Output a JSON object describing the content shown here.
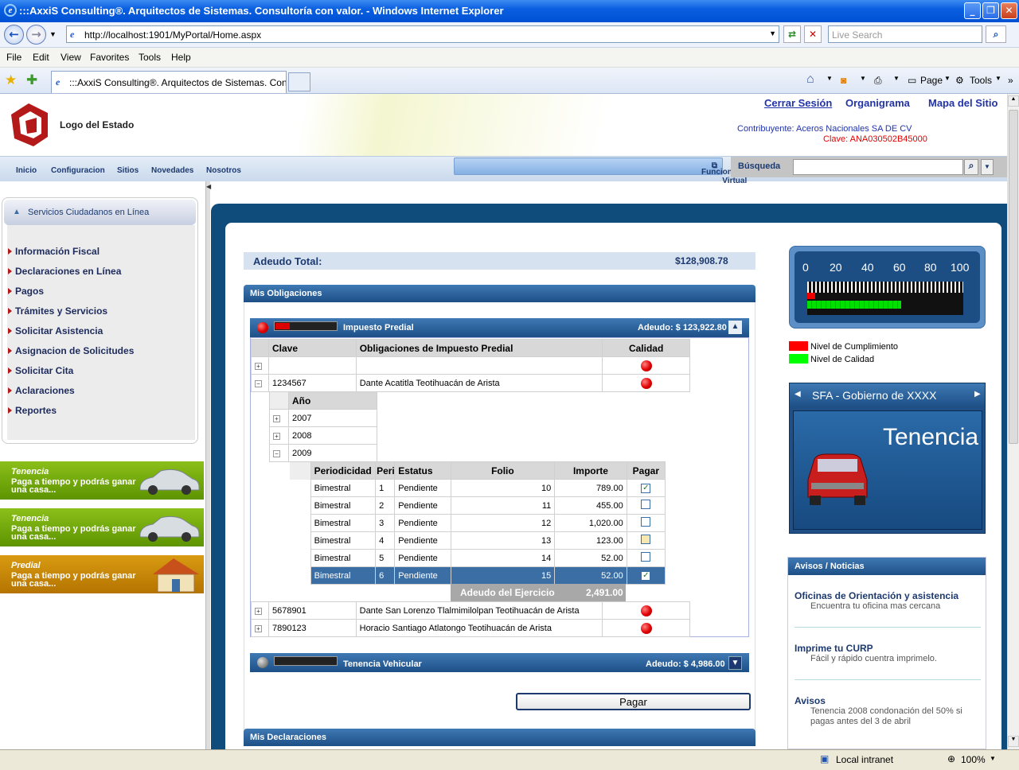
{
  "window": {
    "title": ":::AxxiS Consulting®. Arquitectos de Sistemas. Consultoría con valor. - Windows Internet Explorer"
  },
  "address": {
    "url": "http://localhost:1901/MyPortal/Home.aspx",
    "search_placeholder": "Live Search"
  },
  "menu": [
    "File",
    "Edit",
    "View",
    "Favorites",
    "Tools",
    "Help"
  ],
  "tab": {
    "title": ":::AxxiS Consulting®. Arquitectos de Sistemas. Cons..."
  },
  "commands": {
    "page": "Page",
    "tools": "Tools"
  },
  "header": {
    "logo": "Logo del Estado",
    "links": [
      "Cerrar Sesión",
      "Organigrama",
      "Mapa del Sitio"
    ],
    "contribuyente": "Contribuyente: Aceros Nacionales SA DE CV",
    "clave": "Clave: ANA030502B45000"
  },
  "nav": [
    "Inicio",
    "Configuracion",
    "Sitios",
    "Novedades",
    "Nosotros"
  ],
  "funcionario": "Funcionario Virtual",
  "busqueda": "Búsqueda",
  "left": {
    "title": "Servicios Ciudadanos en Línea",
    "items": [
      "Información Fiscal",
      "Declaraciones en Línea",
      "Pagos",
      "Trámites y Servicios",
      "Solicitar Asistencia",
      "Asignacion de Solicitudes",
      "Solicitar Cita",
      "Aclaraciones",
      "Reportes"
    ],
    "promos": [
      {
        "title": "Tenencia",
        "text": "Paga a tiempo y podrás ganar una casa..."
      },
      {
        "title": "Tenencia",
        "text": "Paga a tiempo y podrás ganar una casa..."
      },
      {
        "title": "Predial",
        "text": "Paga a tiempo y podrás ganar una casa..."
      }
    ]
  },
  "main": {
    "adeudo_label": "Adeudo Total:",
    "adeudo_total": "$128,908.78",
    "obligaciones": "Mis Obligaciones",
    "predial": {
      "title": "Impuesto Predial",
      "adeudo": "Adeudo: $ 123,922.80"
    },
    "cols": [
      "Clave",
      "Obligaciones de Impuesto Predial",
      "Calidad"
    ],
    "rows": [
      {
        "clave": "1234567",
        "desc": "Dante Acatitla Teotihuacán de Arista"
      },
      {
        "clave": "5678901",
        "desc": "Dante San Lorenzo Tlalmimilolpan Teotihuacán de Arista"
      },
      {
        "clave": "7890123",
        "desc": "Horacio Santiago Atlatongo Teotihuacán de Arista"
      }
    ],
    "anio_header": "Año",
    "years": [
      "2007",
      "2008",
      "2009"
    ],
    "detail_cols": [
      "Periodicidad",
      "Peri",
      "Estatus",
      "Folio",
      "Importe",
      "Pagar"
    ],
    "detail": [
      {
        "per": "Bimestral",
        "n": "1",
        "est": "Pendiente",
        "folio": "10",
        "imp": "789.00",
        "pagar": "✓"
      },
      {
        "per": "Bimestral",
        "n": "2",
        "est": "Pendiente",
        "folio": "11",
        "imp": "455.00",
        "pagar": ""
      },
      {
        "per": "Bimestral",
        "n": "3",
        "est": "Pendiente",
        "folio": "12",
        "imp": "1,020.00",
        "pagar": ""
      },
      {
        "per": "Bimestral",
        "n": "4",
        "est": "Pendiente",
        "folio": "13",
        "imp": "123.00",
        "pagar": ""
      },
      {
        "per": "Bimestral",
        "n": "5",
        "est": "Pendiente",
        "folio": "14",
        "imp": "52.00",
        "pagar": ""
      },
      {
        "per": "Bimestral",
        "n": "6",
        "est": "Pendiente",
        "folio": "15",
        "imp": "52.00",
        "pagar": "✓"
      }
    ],
    "ejercicio_label": "Adeudo del Ejercicio",
    "ejercicio_total": "2,491.00",
    "tenencia": {
      "title": "Tenencia Vehicular",
      "adeudo": "Adeudo: $ 4,986.00"
    },
    "pagar": "Pagar",
    "declaraciones": "Mis Declaraciones"
  },
  "right": {
    "ticks": [
      "0",
      "20",
      "40",
      "60",
      "80",
      "100"
    ],
    "gauge_values": {
      "cumplimiento": 5,
      "calidad": 60
    },
    "legend": [
      {
        "label": "Nivel de Cumplimiento",
        "color": "#ff0000"
      },
      {
        "label": "Nivel de Calidad",
        "color": "#00ff00"
      }
    ],
    "sfa_title": "SFA - Gobierno de XXXX",
    "sfa_banner": "Tenencia",
    "avisos_title": "Avisos / Noticias",
    "avisos": [
      {
        "title": "Oficinas de Orientación y asistencia",
        "desc": "Encuentra tu oficina mas cercana"
      },
      {
        "title": "Imprime tu CURP",
        "desc": "Fácil y rápido cuentra imprimelo."
      },
      {
        "title": "Avisos",
        "desc": "Tenencia 2008 condonación del 50% si pagas antes del 3 de abril"
      }
    ]
  },
  "status": {
    "zone": "Local intranet",
    "zoom": "100%"
  }
}
